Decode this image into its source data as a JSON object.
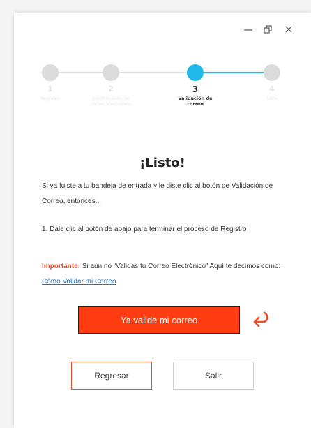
{
  "window_controls": {
    "minimize_icon": "minimize-icon",
    "restore_icon": "restore-icon",
    "close_icon": "close-icon"
  },
  "stepper": {
    "steps": [
      {
        "number": "1",
        "label": "Registro",
        "state": "inactive"
      },
      {
        "number": "2",
        "label": "Confirmación de correo electrónico",
        "state": "inactive"
      },
      {
        "number": "3",
        "label": "Validación de correo",
        "state": "active"
      },
      {
        "number": "4",
        "label": "Listo",
        "state": "inactive"
      }
    ],
    "active_color": "#1fb8e8",
    "inactive_color": "#dcdcdc"
  },
  "main": {
    "title": "¡Listo!",
    "paragraph1": "Si ya fuiste a tu bandeja de entrada y le diste clic al botón de Validación de Correo, entonces...",
    "paragraph2": "1. Dale clic al botón de abajo para terminar el proceso de Registro",
    "important_label": "Importante:",
    "important_text": " Si aún no “Validas tu Correo Electrónico”  Aquí te decimos como: ",
    "important_link": "Cómo Validar mi Correo"
  },
  "actions": {
    "primary_label": "Ya valide mi correo",
    "primary_color": "#ff3d10",
    "back_label": "Regresar",
    "exit_label": "Salir"
  }
}
